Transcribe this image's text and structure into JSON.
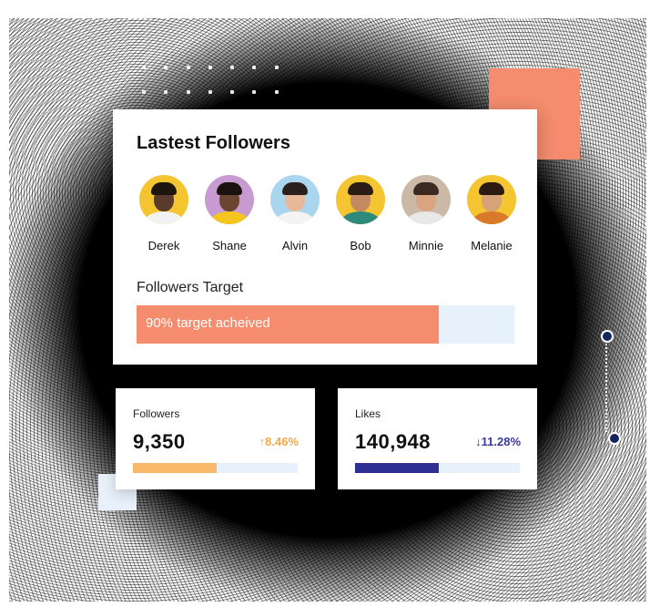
{
  "colors": {
    "accent": "#f48c6d",
    "light_blue": "#e7f1fc",
    "followers_bar": "#f9b96b",
    "followers_change": "#f0a84c",
    "likes_bar": "#2f2f94",
    "likes_change": "#3a3a9a"
  },
  "card": {
    "title": "Lastest Followers",
    "followers": [
      {
        "name": "Derek",
        "bg": "#f5c531",
        "skin": "#5a3a28",
        "hair": "#1e1410",
        "shirt": "#f2f2f2"
      },
      {
        "name": "Shane",
        "bg": "#c79ad1",
        "skin": "#6b4530",
        "hair": "#1a120f",
        "shirt": "#f3c51d"
      },
      {
        "name": "Alvin",
        "bg": "#a9d5ef",
        "skin": "#e7b99a",
        "hair": "#2a1f1a",
        "shirt": "#f4f4f4"
      },
      {
        "name": "Bob",
        "bg": "#f5c531",
        "skin": "#c48b62",
        "hair": "#2b1d15",
        "shirt": "#2e8a7a"
      },
      {
        "name": "Minnie",
        "bg": "#cbb8a6",
        "skin": "#d8a580",
        "hair": "#3a2a20",
        "shirt": "#e8e8e8"
      },
      {
        "name": "Melanie",
        "bg": "#f5c531",
        "skin": "#d6a27a",
        "hair": "#2a1a12",
        "shirt": "#d97a2b"
      }
    ],
    "target_title": "Followers Target",
    "target_text": "90% target acheived",
    "target_progress": 0.8
  },
  "stats": {
    "followers": {
      "label": "Followers",
      "value": "9,350",
      "change": "8.46%",
      "change_arrow": "↑",
      "progress": 0.51
    },
    "likes": {
      "label": "Likes",
      "value": "140,948",
      "change": "11.28%",
      "change_arrow": "↓",
      "progress": 0.51
    }
  }
}
